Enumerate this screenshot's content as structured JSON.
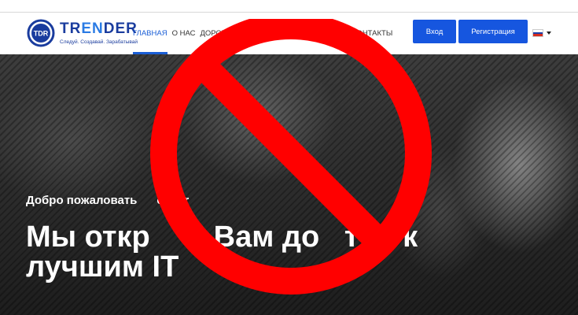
{
  "brand": {
    "logo_mark": "TDR",
    "name_part1": "TR",
    "name_part2": "EN",
    "name_part3": "DER",
    "tagline": "Следуй. Создавай. Зарабатывай"
  },
  "nav": {
    "items": [
      {
        "label": "Главная",
        "active": true
      },
      {
        "label": "О нас",
        "active": false
      },
      {
        "label": "Дорожна",
        "active": false
      },
      {
        "label": "Контакты",
        "active": false
      }
    ]
  },
  "header_buttons": {
    "login_label": "Вход",
    "register_label": "Регистрация"
  },
  "language": {
    "flag_colors": [
      "#ffffff",
      "#1c3fa8",
      "#d52b1e"
    ],
    "caret_icon": "chevron-down-icon"
  },
  "hero": {
    "welcome_text": "Добро пожаловать      ender",
    "headline": "Мы откр    м Вам до   туп к лучшим IT"
  },
  "overlay": {
    "icon": "prohibited-sign-icon",
    "color": "#ff0000"
  },
  "colors": {
    "accent": "#1656df",
    "brand": "#1a3c9e"
  }
}
